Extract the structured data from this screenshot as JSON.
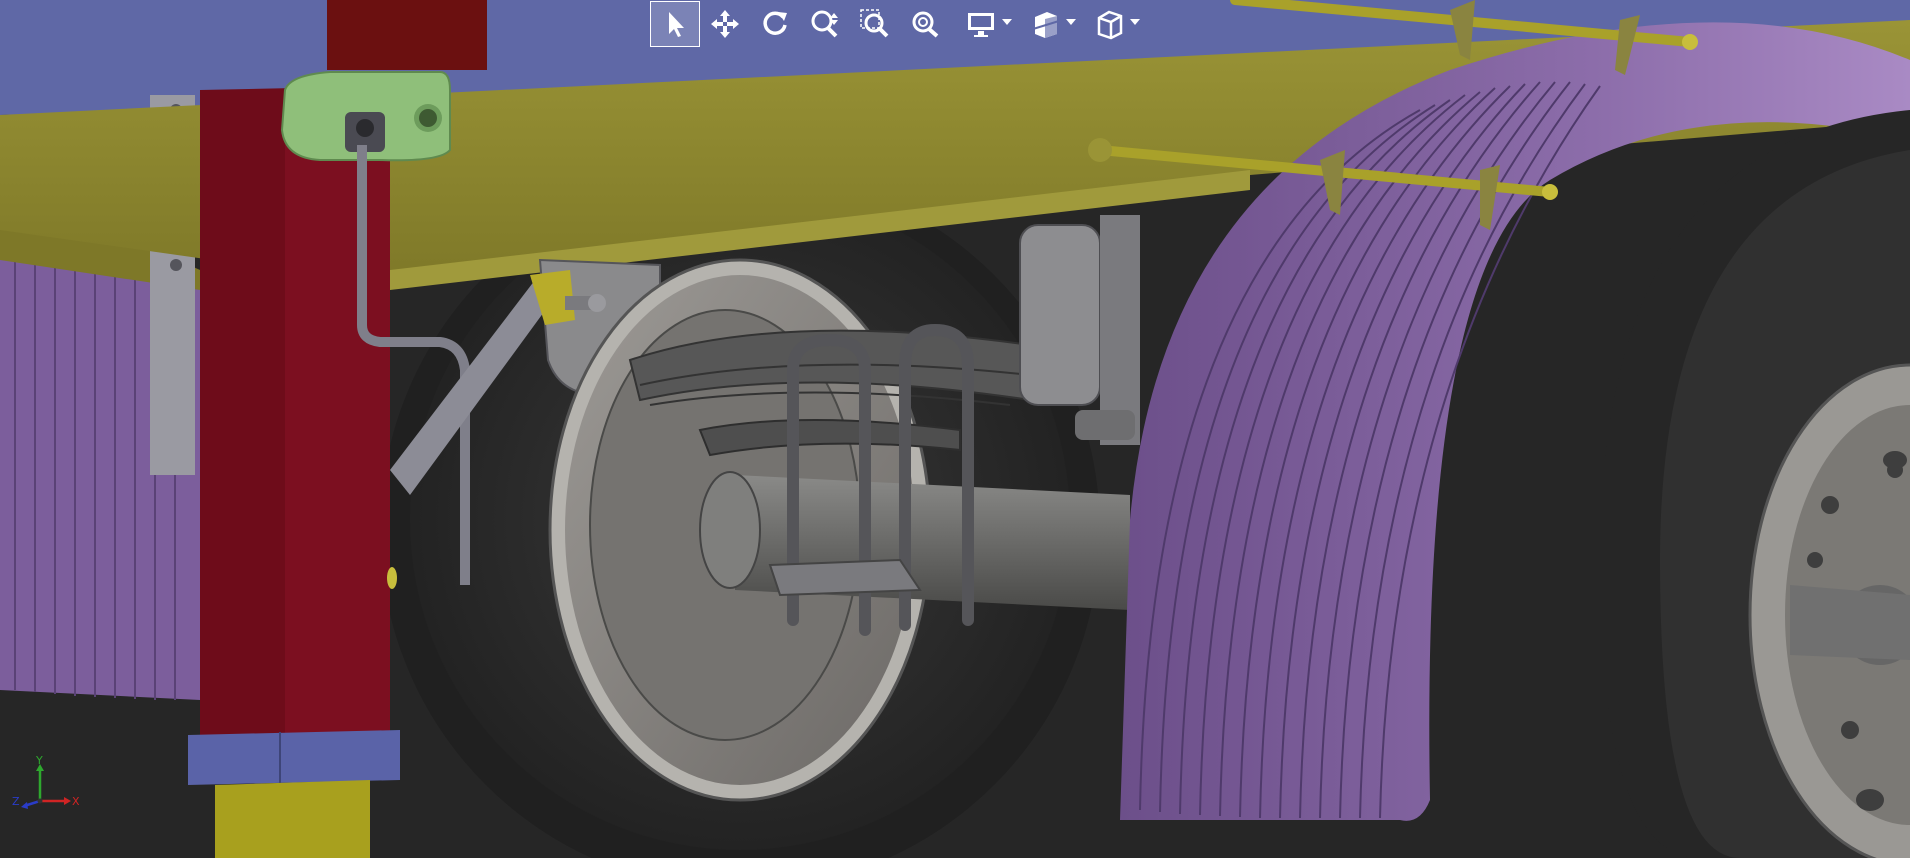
{
  "toolbar": {
    "tools": [
      {
        "icon": "select-arrow-icon",
        "active": true
      },
      {
        "icon": "pan-move-icon",
        "active": false
      },
      {
        "icon": "rotate-icon",
        "active": false
      },
      {
        "icon": "zoom-in-out-icon",
        "active": false
      },
      {
        "icon": "zoom-to-area-icon",
        "active": false
      },
      {
        "icon": "zoom-to-fit-icon",
        "active": false
      },
      {
        "icon": "display-style-icon",
        "dropdown": true
      },
      {
        "icon": "section-view-icon",
        "dropdown": true
      },
      {
        "icon": "view-orientation-cube-icon",
        "dropdown": true
      }
    ]
  },
  "triad": {
    "x_label": "X",
    "y_label": "Y",
    "z_label": "Z"
  },
  "colors": {
    "frame_rail": "#8c8530",
    "post_red": "#7a0e1c",
    "fender_purple": "#8a6aa8",
    "tire_dark": "#2c2c2c",
    "bracket_green": "#8fbf7a",
    "sky_blue": "#5f68a6",
    "toolbar_highlight": "#ffffff"
  }
}
